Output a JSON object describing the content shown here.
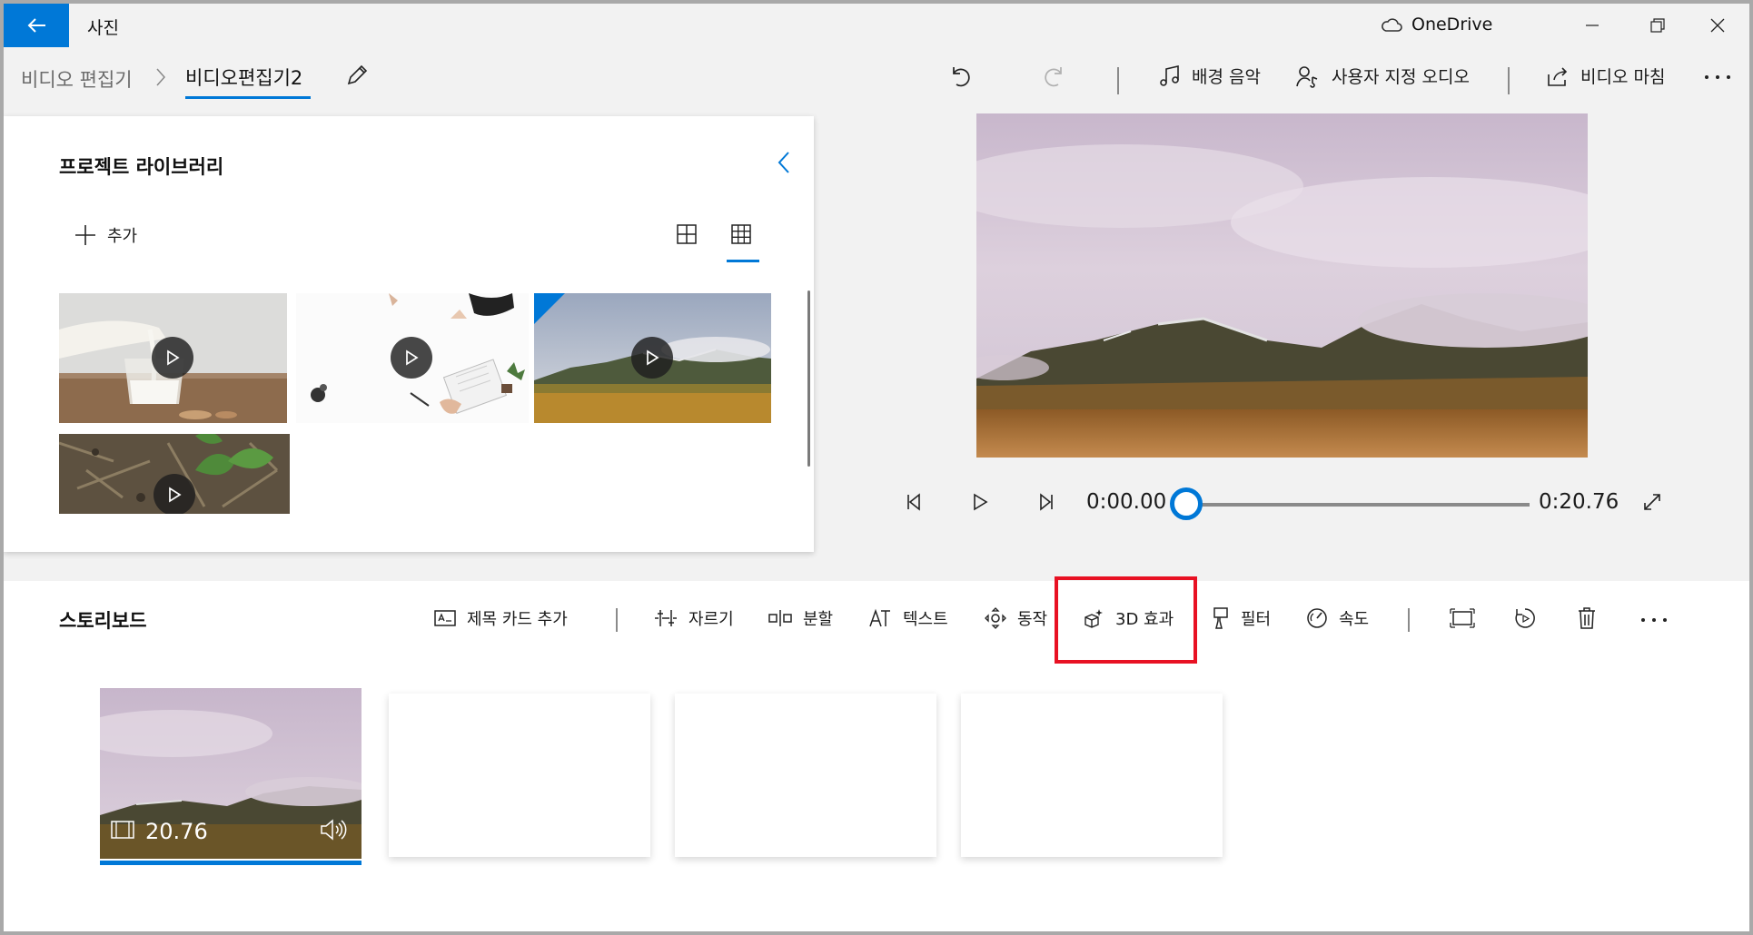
{
  "window": {
    "app_title": "사진",
    "onedrive_label": "OneDrive"
  },
  "breadcrumb": {
    "root": "비디오 편집기",
    "current": "비디오편집기2"
  },
  "toolbar": {
    "background_music": "배경 음악",
    "custom_audio": "사용자 지정 오디오",
    "finish_video": "비디오 마침"
  },
  "library": {
    "title": "프로젝트 라이브러리",
    "add_label": "추가",
    "items": [
      {
        "name": "milk-pour",
        "has_play": true
      },
      {
        "name": "desk-writing",
        "has_play": true
      },
      {
        "name": "mountain-landscape",
        "has_play": true,
        "in_use": true
      },
      {
        "name": "forest-floor",
        "has_play": true
      }
    ]
  },
  "player": {
    "current_time": "0:00.00",
    "total_time": "0:20.76",
    "progress": 0
  },
  "storyboard": {
    "title": "스토리보드",
    "tools": {
      "add_title_card": "제목 카드 추가",
      "trim": "자르기",
      "split": "분할",
      "text": "텍스트",
      "motion": "동작",
      "effects_3d": "3D 효과",
      "filters": "필터",
      "speed": "속도"
    },
    "clips": [
      {
        "duration": "20.76",
        "selected": true,
        "has_audio": true
      },
      {
        "empty": true
      },
      {
        "empty": true
      },
      {
        "empty": true
      }
    ]
  },
  "colors": {
    "accent": "#0078d7",
    "highlight": "#e81123",
    "panel_bg": "#ffffff",
    "window_bg": "#f2f2f2"
  }
}
